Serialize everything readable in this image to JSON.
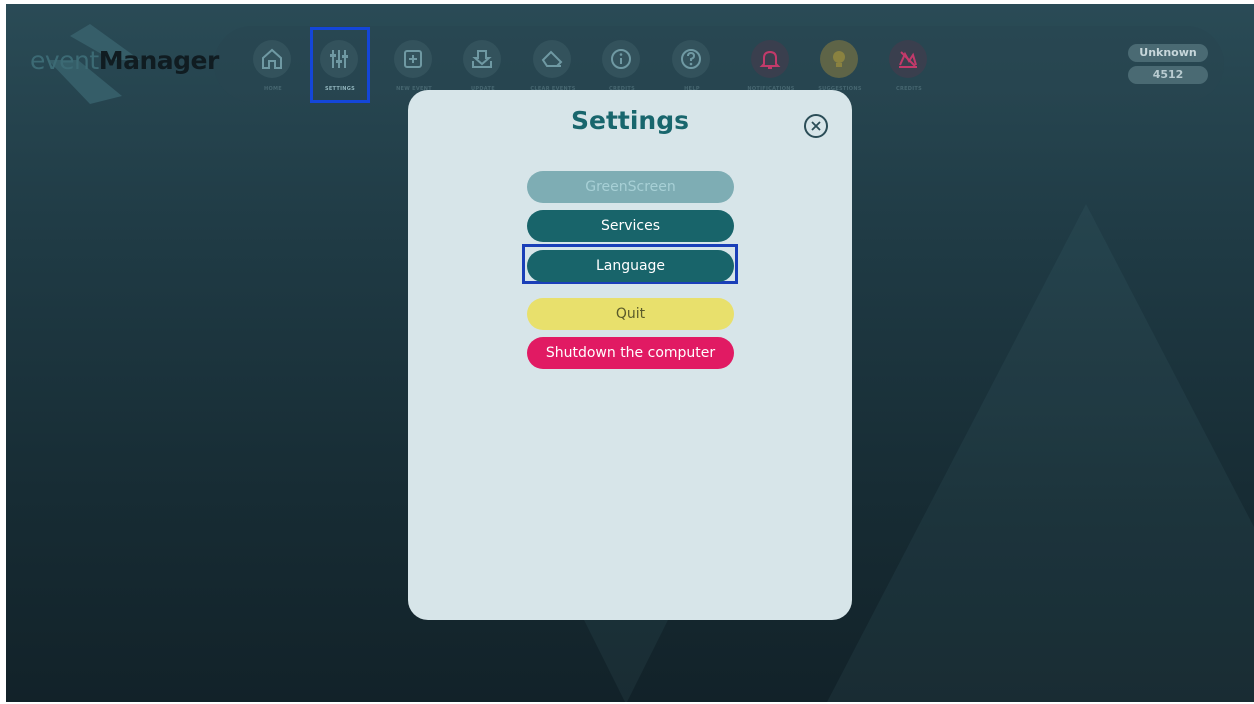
{
  "app": {
    "logo": {
      "part1": "event",
      "part2": "Manager"
    },
    "nav": [
      {
        "label": "HOME",
        "icon": "home-icon",
        "color": "#6f99a3"
      },
      {
        "label": "SETTINGS",
        "icon": "sliders-icon",
        "color": "#6f99a3",
        "selected": true
      },
      {
        "label": "NEW EVENT",
        "icon": "plus-square-icon",
        "color": "#6f99a3"
      },
      {
        "label": "UPDATE",
        "icon": "download-icon",
        "color": "#6f99a3"
      },
      {
        "label": "CLEAR EVENTS",
        "icon": "eraser-icon",
        "color": "#6f99a3"
      },
      {
        "label": "CREDITS",
        "icon": "info-icon",
        "color": "#6f99a3"
      },
      {
        "label": "HELP",
        "icon": "question-icon",
        "color": "#6f99a3"
      },
      {
        "label": "NOTIFICATIONS",
        "icon": "bell-icon",
        "color": "#c23a6a"
      },
      {
        "label": "SUGGESTIONS",
        "icon": "lightbulb-icon",
        "color": "#b8a64a"
      },
      {
        "label": "CREDITS",
        "icon": "signature-icon",
        "color": "#c23a6a"
      }
    ],
    "user": {
      "name": "Unknown",
      "id": "4512"
    }
  },
  "modal": {
    "title": "Settings",
    "close_icon": "close-icon",
    "buttons": {
      "greenscreen": "GreenScreen",
      "services": "Services",
      "language": "Language",
      "quit": "Quit",
      "shutdown": "Shutdown the computer"
    }
  }
}
